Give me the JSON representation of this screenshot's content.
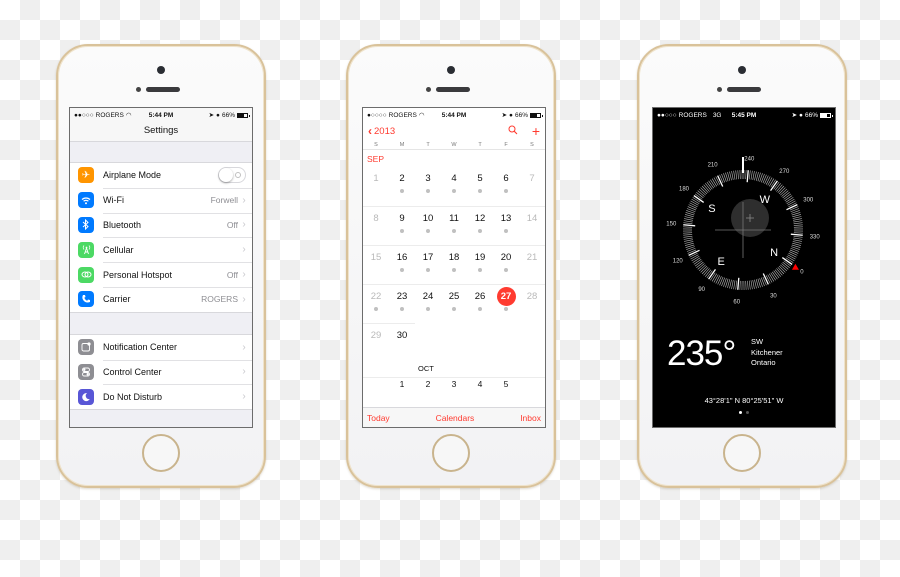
{
  "phones": {
    "settings": {
      "status": {
        "carrier": "ROGERS",
        "time": "5:44 PM",
        "battery": "66%"
      },
      "title": "Settings",
      "group1": [
        {
          "label": "Airplane Mode",
          "icon": "airplane-icon",
          "color": "#ff9500",
          "toggle": false
        },
        {
          "label": "Wi-Fi",
          "value": "Forwell",
          "icon": "wifi-icon",
          "color": "#007aff"
        },
        {
          "label": "Bluetooth",
          "value": "Off",
          "icon": "bluetooth-icon",
          "color": "#007aff"
        },
        {
          "label": "Cellular",
          "value": "",
          "icon": "cellular-icon",
          "color": "#4cd964"
        },
        {
          "label": "Personal Hotspot",
          "value": "Off",
          "icon": "hotspot-icon",
          "color": "#4cd964"
        },
        {
          "label": "Carrier",
          "value": "ROGERS",
          "icon": "phone-icon",
          "color": "#007aff"
        }
      ],
      "group2": [
        {
          "label": "Notification Center",
          "icon": "notification-center-icon",
          "color": "#8e8e93"
        },
        {
          "label": "Control Center",
          "icon": "control-center-icon",
          "color": "#8e8e93"
        },
        {
          "label": "Do Not Disturb",
          "icon": "moon-icon",
          "color": "#5856d6"
        }
      ]
    },
    "calendar": {
      "status": {
        "carrier": "ROGERS",
        "time": "5:44 PM",
        "battery": "66%"
      },
      "back_label": "2013",
      "weekdays": [
        "S",
        "M",
        "T",
        "W",
        "T",
        "F",
        "S"
      ],
      "month": "SEP",
      "weeks": [
        [
          "1",
          "2",
          "3",
          "4",
          "5",
          "6",
          "7"
        ],
        [
          "8",
          "9",
          "10",
          "11",
          "12",
          "13",
          "14"
        ],
        [
          "15",
          "16",
          "17",
          "18",
          "19",
          "20",
          "21"
        ],
        [
          "22",
          "23",
          "24",
          "25",
          "26",
          "27",
          "28"
        ]
      ],
      "last_week": [
        "29",
        "30"
      ],
      "today": "27",
      "next_month": "OCT",
      "next_month_days": [
        "1",
        "2",
        "3",
        "4",
        "5"
      ],
      "tabs": {
        "today": "Today",
        "calendars": "Calendars",
        "inbox": "Inbox"
      },
      "accent": "#ff3b30"
    },
    "compass": {
      "status": {
        "carrier": "ROGERS",
        "network": "3G",
        "time": "5:45 PM",
        "battery": "66%"
      },
      "dial_labels": [
        "0",
        "30",
        "60",
        "90",
        "120",
        "150",
        "180",
        "210",
        "240",
        "270",
        "300",
        "330"
      ],
      "cardinals": [
        "N",
        "E",
        "S",
        "W"
      ],
      "heading_deg": 235,
      "heading_text": "235°",
      "direction": "SW",
      "city": "Kitchener",
      "region": "Ontario",
      "coordinates": "43°28'1\" N  80°25'51\" W",
      "page_count": 2,
      "current_page": 1,
      "north_marker_color": "#ff0000"
    }
  }
}
